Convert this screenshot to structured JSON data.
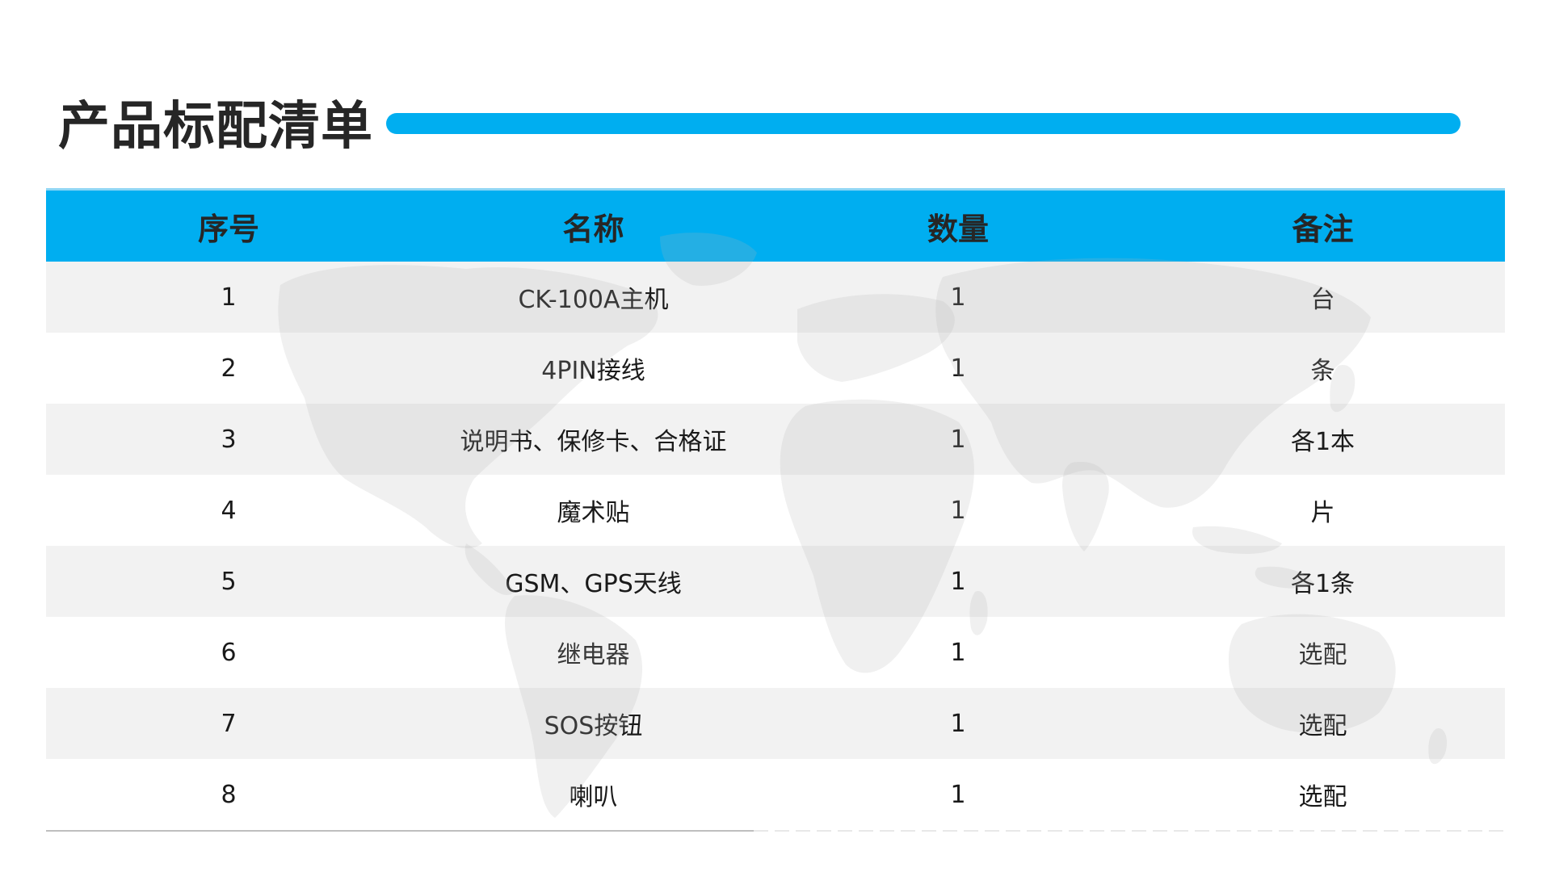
{
  "title": "产品标配清单",
  "colors": {
    "accent": "#00aef0",
    "row_alt": "#f2f2f2",
    "title_text": "#262626"
  },
  "table": {
    "headers": [
      "序号",
      "名称",
      "数量",
      "备注"
    ],
    "rows": [
      {
        "index": "1",
        "name": "CK-100A主机",
        "qty": "1",
        "note": "台"
      },
      {
        "index": "2",
        "name": "4PIN接线",
        "qty": "1",
        "note": "条"
      },
      {
        "index": "3",
        "name": "说明书、保修卡、合格证",
        "qty": "1",
        "note": "各1本"
      },
      {
        "index": "4",
        "name": "魔术贴",
        "qty": "1",
        "note": "片"
      },
      {
        "index": "5",
        "name": "GSM、GPS天线",
        "qty": "1",
        "note": "各1条"
      },
      {
        "index": "6",
        "name": "继电器",
        "qty": "1",
        "note": "选配"
      },
      {
        "index": "7",
        "name": "SOS按钮",
        "qty": "1",
        "note": "选配"
      },
      {
        "index": "8",
        "name": "喇叭",
        "qty": "1",
        "note": "选配"
      }
    ]
  },
  "background_icon": "world-map-watermark"
}
